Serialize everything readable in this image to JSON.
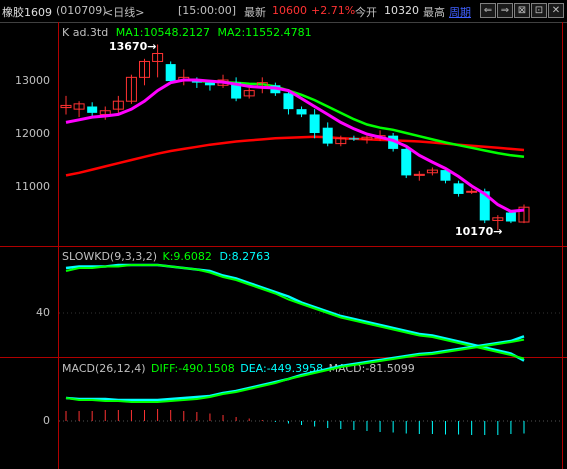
{
  "topbar": {
    "symbol": "橡胶1609",
    "code": "(010709)",
    "period": "<日线>",
    "time": "[15:00:00]",
    "latest_label": "最新",
    "latest_value": "10600",
    "change_pct": "+2.71%",
    "open_label": "今开",
    "open_value": "10320",
    "high_label": "最高",
    "cycle_label": "周期"
  },
  "window_buttons": [
    "⇐",
    "⇒",
    "⊠",
    "⊡",
    "✕"
  ],
  "main_panel": {
    "title_prefix": "K  ad.3td",
    "ma1": "MA1:10548.2127",
    "ma2": "MA2:11552.4781",
    "high_mark": "13670",
    "low_mark": "10170",
    "y_labels": [
      "13000",
      "12000",
      "11000"
    ]
  },
  "kd_panel": {
    "title": "SLOWKD(9,3,3,2)",
    "k": "K:9.6082",
    "d": "D:8.2763",
    "y_labels": [
      "40"
    ]
  },
  "macd_panel": {
    "title": "MACD(26,12,4)",
    "diff": "DIFF:-490.1508",
    "dea": "DEA:-449.3958",
    "macd": "MACD:-81.5099",
    "y_labels": [
      "0"
    ]
  },
  "colors": {
    "up": "#ff3232",
    "down": "#00ffff",
    "ma_fast": "#ff00ff",
    "ma_green": "#00ff00",
    "ma_red": "#ff0000",
    "k_line": "#00ff00",
    "d_line": "#00ffff"
  },
  "chart_data": {
    "type": "candlestick",
    "candles": [
      {
        "o": 12480,
        "h": 12700,
        "l": 12350,
        "c": 12520
      },
      {
        "o": 12450,
        "h": 12600,
        "l": 12300,
        "c": 12550
      },
      {
        "o": 12500,
        "h": 12580,
        "l": 12280,
        "c": 12380
      },
      {
        "o": 12350,
        "h": 12500,
        "l": 12250,
        "c": 12420
      },
      {
        "o": 12450,
        "h": 12700,
        "l": 12350,
        "c": 12600
      },
      {
        "o": 12600,
        "h": 13100,
        "l": 12550,
        "c": 13050
      },
      {
        "o": 13050,
        "h": 13400,
        "l": 12900,
        "c": 13350
      },
      {
        "o": 13350,
        "h": 13670,
        "l": 13050,
        "c": 13500
      },
      {
        "o": 13300,
        "h": 13350,
        "l": 12950,
        "c": 12980
      },
      {
        "o": 13000,
        "h": 13200,
        "l": 12900,
        "c": 13050
      },
      {
        "o": 13000,
        "h": 13050,
        "l": 12850,
        "c": 12950
      },
      {
        "o": 12950,
        "h": 13000,
        "l": 12800,
        "c": 12900
      },
      {
        "o": 12900,
        "h": 13100,
        "l": 12850,
        "c": 13000
      },
      {
        "o": 12950,
        "h": 13050,
        "l": 12600,
        "c": 12650
      },
      {
        "o": 12700,
        "h": 12850,
        "l": 12650,
        "c": 12800
      },
      {
        "o": 12850,
        "h": 13050,
        "l": 12750,
        "c": 12950
      },
      {
        "o": 12900,
        "h": 12950,
        "l": 12700,
        "c": 12750
      },
      {
        "o": 12750,
        "h": 12800,
        "l": 12350,
        "c": 12450
      },
      {
        "o": 12450,
        "h": 12500,
        "l": 12300,
        "c": 12350
      },
      {
        "o": 12350,
        "h": 12450,
        "l": 11900,
        "c": 12000
      },
      {
        "o": 12100,
        "h": 12200,
        "l": 11750,
        "c": 11800
      },
      {
        "o": 11800,
        "h": 11950,
        "l": 11750,
        "c": 11900
      },
      {
        "o": 11900,
        "h": 11950,
        "l": 11850,
        "c": 11880
      },
      {
        "o": 11880,
        "h": 11950,
        "l": 11800,
        "c": 11920
      },
      {
        "o": 11900,
        "h": 12050,
        "l": 11850,
        "c": 11950
      },
      {
        "o": 11950,
        "h": 12000,
        "l": 11650,
        "c": 11700
      },
      {
        "o": 11700,
        "h": 11750,
        "l": 11150,
        "c": 11200
      },
      {
        "o": 11200,
        "h": 11280,
        "l": 11100,
        "c": 11220
      },
      {
        "o": 11250,
        "h": 11350,
        "l": 11200,
        "c": 11300
      },
      {
        "o": 11300,
        "h": 11350,
        "l": 11050,
        "c": 11100
      },
      {
        "o": 11050,
        "h": 11100,
        "l": 10800,
        "c": 10850
      },
      {
        "o": 10900,
        "h": 10950,
        "l": 10850,
        "c": 10900
      },
      {
        "o": 10900,
        "h": 10950,
        "l": 10300,
        "c": 10350
      },
      {
        "o": 10350,
        "h": 10450,
        "l": 10170,
        "c": 10400
      },
      {
        "o": 10500,
        "h": 10550,
        "l": 10300,
        "c": 10330
      },
      {
        "o": 10320,
        "h": 10650,
        "l": 10300,
        "c": 10600
      }
    ],
    "ma_fast": [
      12200,
      12250,
      12300,
      12320,
      12350,
      12450,
      12600,
      12800,
      12950,
      13000,
      13000,
      12980,
      12960,
      12920,
      12880,
      12860,
      12850,
      12800,
      12650,
      12500,
      12350,
      12200,
      12080,
      11980,
      11920,
      11860,
      11750,
      11580,
      11450,
      11330,
      11180,
      11000,
      10850,
      10650,
      10520,
      10548
    ],
    "ma_green": [
      null,
      null,
      null,
      null,
      null,
      null,
      null,
      null,
      null,
      null,
      12980,
      12970,
      12960,
      12950,
      12930,
      12920,
      12880,
      12800,
      12720,
      12620,
      12500,
      12380,
      12260,
      12160,
      12100,
      12060,
      12000,
      11940,
      11880,
      11820,
      11770,
      11720,
      11670,
      11620,
      11580,
      11552
    ],
    "ma_red": [
      11200,
      11250,
      11310,
      11370,
      11430,
      11490,
      11550,
      11610,
      11660,
      11700,
      11740,
      11780,
      11810,
      11840,
      11860,
      11880,
      11900,
      11910,
      11920,
      11930,
      11920,
      11900,
      11890,
      11880,
      11870,
      11860,
      11850,
      11840,
      11820,
      11800,
      11780,
      11760,
      11740,
      11720,
      11700,
      11680
    ],
    "k": [
      68,
      70,
      70,
      71,
      71,
      72,
      72,
      72,
      71,
      70,
      69,
      67,
      64,
      62,
      59,
      56,
      53,
      49,
      46,
      43,
      40,
      37,
      35,
      33,
      31,
      29,
      27,
      25,
      24,
      22,
      20,
      18,
      16,
      14,
      12,
      9.6
    ],
    "d": [
      70,
      71,
      71,
      71,
      72,
      72,
      72,
      72,
      71,
      70,
      69,
      68,
      65,
      63,
      60,
      57,
      54,
      51,
      47,
      44,
      41,
      38,
      36,
      34,
      32,
      30,
      28,
      26,
      25,
      23,
      21,
      19,
      17,
      15,
      13,
      8.3
    ],
    "macd_bars": [
      20,
      20,
      20,
      22,
      22,
      22,
      22,
      24,
      22,
      20,
      18,
      15,
      12,
      8,
      5,
      2,
      -2,
      -5,
      -8,
      -11,
      -14,
      -16,
      -18,
      -20,
      -22,
      -23,
      -25,
      -26,
      -26,
      -27,
      -27,
      -28,
      -28,
      -28,
      -26,
      -25
    ]
  }
}
